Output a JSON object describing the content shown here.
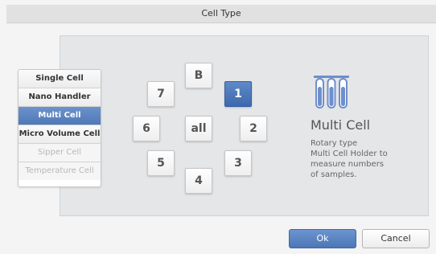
{
  "dialog": {
    "title": "Cell Type"
  },
  "cell_types": {
    "items": [
      {
        "label": "Single Cell",
        "state": "normal"
      },
      {
        "label": "Nano Handler",
        "state": "normal"
      },
      {
        "label": "Multi Cell",
        "state": "selected"
      },
      {
        "label": "Micro Volume Cell",
        "state": "normal"
      },
      {
        "label": "Sipper Cell",
        "state": "disabled"
      },
      {
        "label": "Temperature Cell",
        "state": "disabled"
      }
    ]
  },
  "positions": {
    "selected": "1",
    "buttons": {
      "b": "B",
      "p1": "1",
      "p2": "2",
      "p3": "3",
      "p4": "4",
      "p5": "5",
      "p6": "6",
      "p7": "7",
      "all": "all"
    }
  },
  "description": {
    "title": "Multi Cell",
    "lines": [
      "Rotary type",
      "Multi Cell Holder to",
      "measure numbers",
      "of samples."
    ],
    "icon": "multi-cell-holder-icon",
    "icon_color": "#6e8fcc"
  },
  "actions": {
    "ok": "Ok",
    "cancel": "Cancel"
  },
  "colors": {
    "accent": "#4f78b7",
    "selected_text": "#ffffff"
  }
}
